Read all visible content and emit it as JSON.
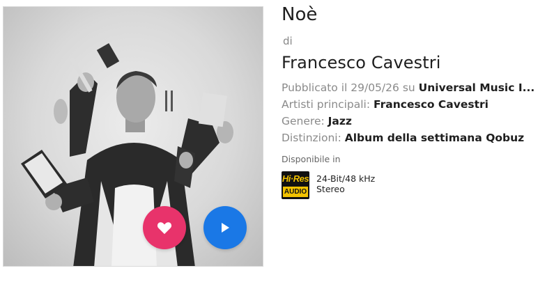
{
  "album": {
    "title": "Noè",
    "by_label": "di",
    "artist": "Francesco Cavestri"
  },
  "meta": {
    "published_prefix": "Pubblicato il",
    "published_date": "29/05/26",
    "published_on": "su",
    "label": "Universal Music I...",
    "main_artists_label": "Artisti principali:",
    "main_artists": "Francesco Cavestri",
    "genre_label": "Genere:",
    "genre": "Jazz",
    "awards_label": "Distinzioni:",
    "awards": "Album della settimana Qobuz"
  },
  "availability": {
    "label": "Disponibile in",
    "badge_top": "Hi·Res",
    "badge_bottom": "AUDIO",
    "bit_rate": "24-Bit/48 kHz",
    "channels": "Stereo"
  },
  "colors": {
    "favorite": "#e8336b",
    "play": "#1a78e6",
    "hires_gold": "#f2c200"
  },
  "icons": {
    "favorite": "heart-icon",
    "play": "play-icon"
  }
}
